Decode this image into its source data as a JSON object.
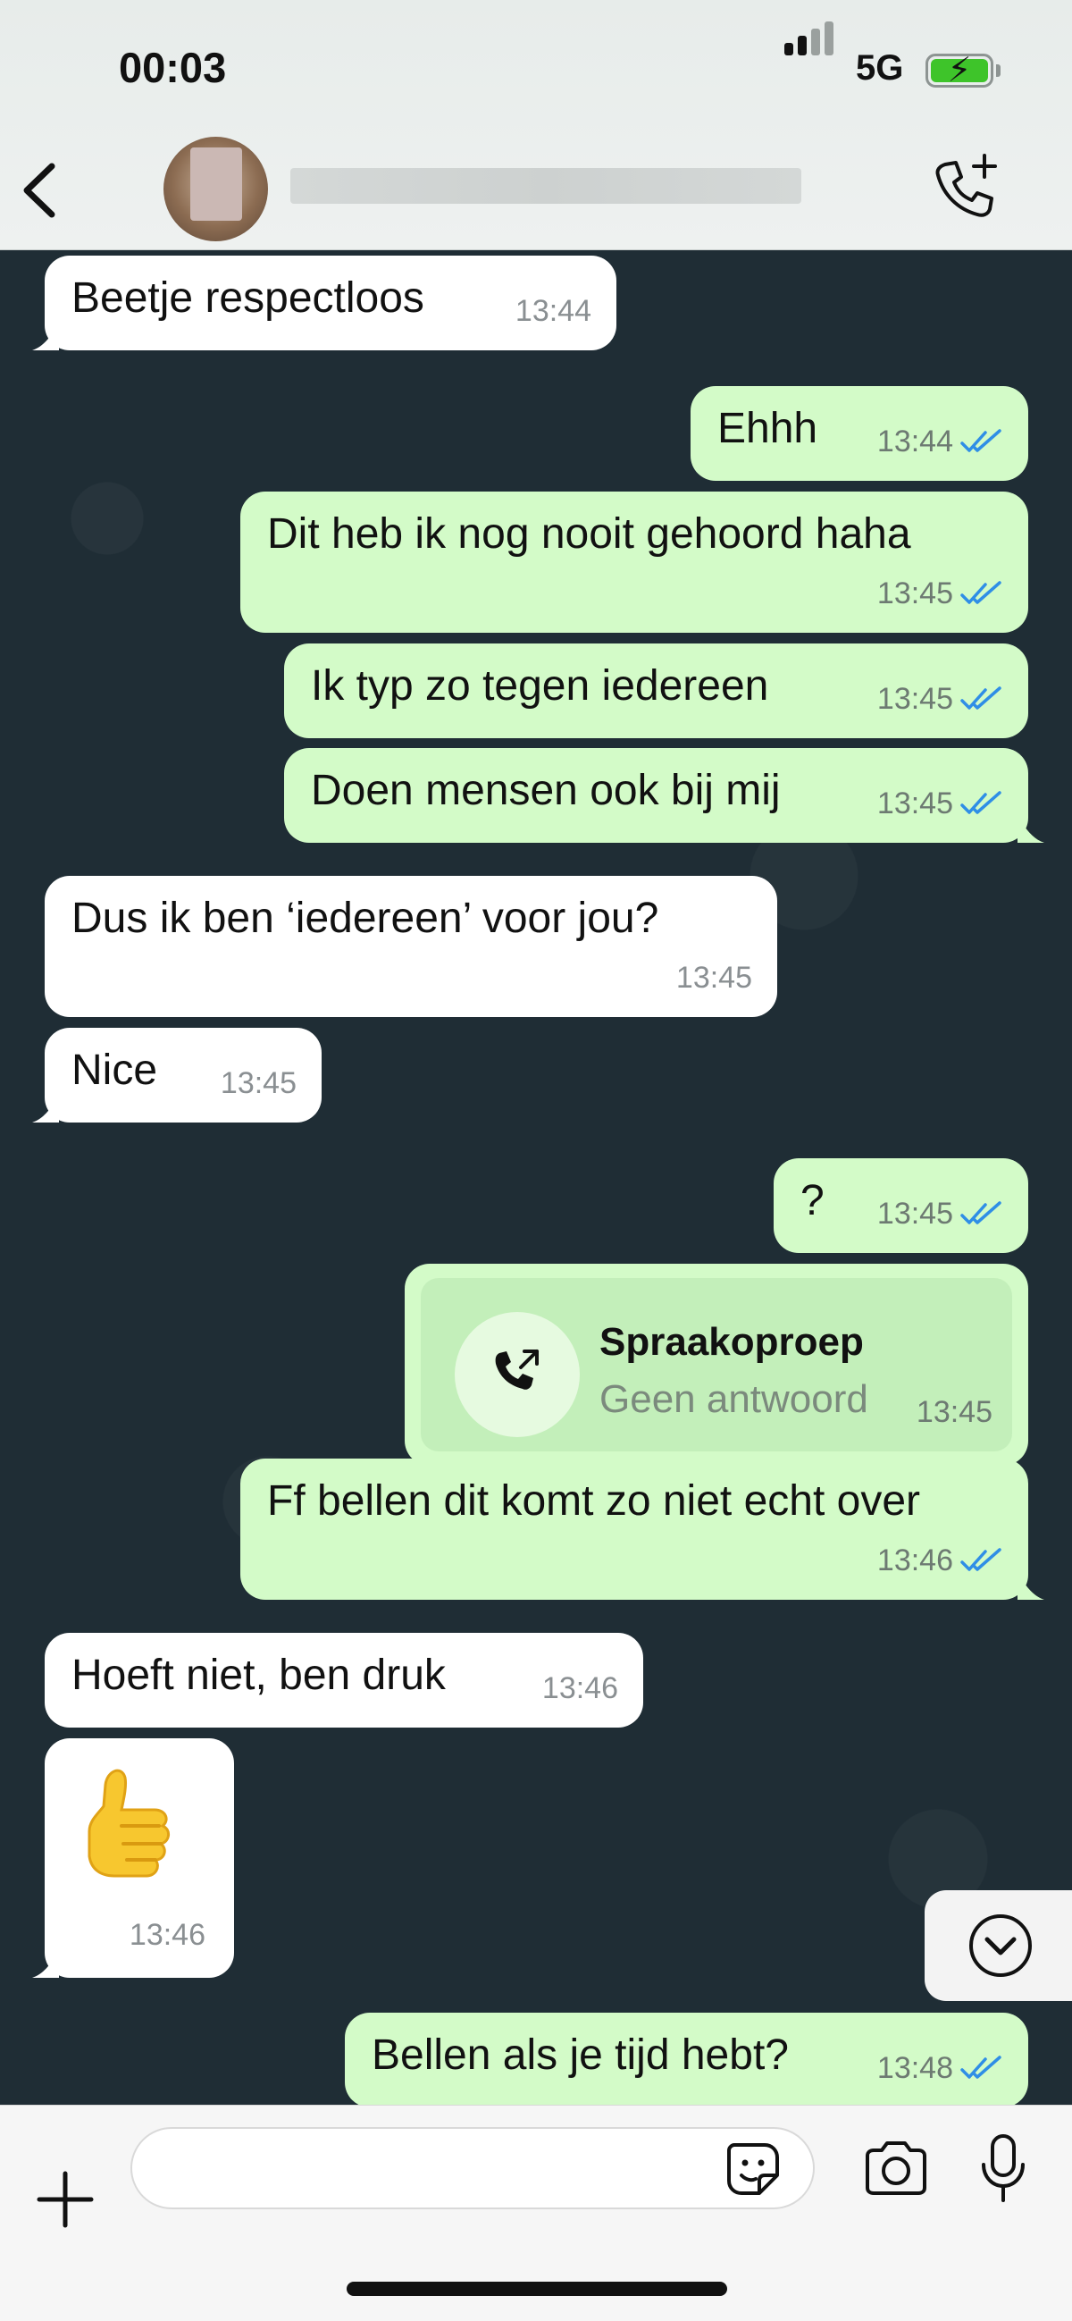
{
  "status_bar": {
    "time": "00:03",
    "network": "5G",
    "battery_bolt": "⚡"
  },
  "header": {
    "back_icon": "chevron-left-icon",
    "call_icon": "phone-add-icon"
  },
  "messages": [
    {
      "dir": "in",
      "text": "Beetje respectloos",
      "time": "13:44"
    },
    {
      "dir": "out",
      "text": "Ehhh",
      "time": "13:44"
    },
    {
      "dir": "out",
      "text": "Dit heb ik nog nooit gehoord haha",
      "time": "13:45"
    },
    {
      "dir": "out",
      "text": "Ik typ zo tegen iedereen",
      "time": "13:45"
    },
    {
      "dir": "out",
      "text": "Doen mensen ook bij mij",
      "time": "13:45"
    },
    {
      "dir": "in",
      "text": "Dus ik ben ‘iedereen’ voor jou?",
      "time": "13:45"
    },
    {
      "dir": "in",
      "text": "Nice",
      "time": "13:45"
    },
    {
      "dir": "out",
      "text": "?",
      "time": "13:45"
    },
    {
      "dir": "out",
      "type": "call",
      "title": "Spraakoproep",
      "subtitle": "Geen antwoord",
      "time": "13:45"
    },
    {
      "dir": "out",
      "text": "Ff bellen dit komt zo niet echt over",
      "time": "13:46"
    },
    {
      "dir": "in",
      "text": "Hoeft niet, ben druk",
      "time": "13:46"
    },
    {
      "dir": "in",
      "type": "emoji",
      "emoji": "thumbs-up",
      "time": "13:46"
    },
    {
      "dir": "out",
      "text": "Bellen als je tijd hebt?",
      "time": "13:48"
    }
  ],
  "colors": {
    "chat_background": "#1f2d35",
    "incoming_bubble": "#ffffff",
    "outgoing_bubble": "#d3fbc8",
    "read_ticks": "#2f8ee6"
  },
  "input": {
    "value": "",
    "placeholder": ""
  }
}
